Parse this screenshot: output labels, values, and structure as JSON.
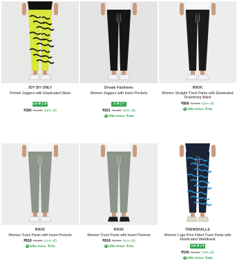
{
  "products": [
    {
      "brand": "JOY BY ONLY",
      "title": "Printed Joggers with Elasticated Waist",
      "rating": "3.5 ★ | 47",
      "price": "₹380",
      "mrp": "₹1,099",
      "discount": "(65% off)",
      "offer": "",
      "colors": {
        "bg": "#e8e8e6",
        "pant": "#d9e63a",
        "pattern": "#111111",
        "shoe": "#f2f2f2",
        "top": "#111111"
      }
    },
    {
      "brand": "Dream Fashions",
      "title": "Women Joggers with Insert Pockets",
      "rating": "3 ★ | 7",
      "price": "₹591",
      "mrp": "₹1,299",
      "discount": "(55% off)",
      "offer": "Offer Price: ₹443",
      "colors": {
        "bg": "#e4e4e4",
        "pant": "#151515",
        "pattern": "#151515",
        "shoe": "#f4f4f4",
        "top": "#f0f0f0"
      }
    },
    {
      "brand": "RIKIK",
      "title": "Women Straight Track Pants with Elasticated Drawstring Waist",
      "rating": "",
      "price": "₹808",
      "mrp": "₹2,099",
      "discount": "(62% off)",
      "offer": "Offer Price: ₹701",
      "colors": {
        "bg": "#ededed",
        "pant": "#1a1a1a",
        "pattern": "#1a1a1a",
        "shoe": "#f4f4f4",
        "top": "#f7f7f7"
      }
    },
    {
      "brand": "RIKIK",
      "title": "Women Track Pants with Insert Pockets",
      "rating": "",
      "price": "₹818",
      "mrp": "₹2,099",
      "discount": "(61% off)",
      "offer": "Offer Price: ₹701",
      "colors": {
        "bg": "#ededed",
        "pant": "#8d958a",
        "pattern": "#8d958a",
        "shoe": "#f4f4f4",
        "top": "#f7f7f7"
      }
    },
    {
      "brand": "RIKIK",
      "title": "Women Track Pants with Insert Pockets",
      "rating": "",
      "price": "₹818",
      "mrp": "₹2,099",
      "discount": "(61% off)",
      "offer": "Offer Price: ₹701",
      "colors": {
        "bg": "#ededed",
        "pant": "#8b9488",
        "pattern": "#8b9488",
        "shoe": "#1a1a1a",
        "top": "#f7f7f7"
      }
    },
    {
      "brand": "TRENDHALLS",
      "title": "Women Logo Print Fitted Track Pants with Elasticated Waistband",
      "rating": "3.5 ★ | 6",
      "price": "₹549",
      "mrp": "₹2,499",
      "discount": "(78% off)",
      "offer": "Offer Price: ₹393",
      "colors": {
        "bg": "#ffffff",
        "pant": "#1b2436",
        "pattern": "#2c8fc9",
        "shoe": "#e0d7c6",
        "top": "#1b2436"
      }
    }
  ]
}
